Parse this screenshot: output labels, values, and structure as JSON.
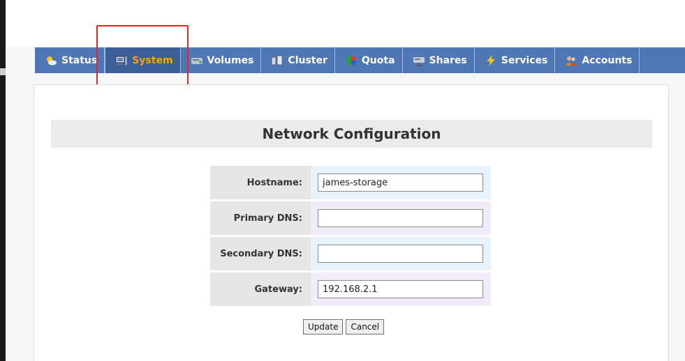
{
  "colors": {
    "tabbar_bg": "#4f77b6",
    "active_tab_text": "#f7a21c",
    "highlight_box": "#ee2222"
  },
  "tabs": [
    {
      "label": "Status",
      "icon": "weather-icon",
      "active": false
    },
    {
      "label": "System",
      "icon": "computer-icon",
      "active": true
    },
    {
      "label": "Volumes",
      "icon": "disk-drive-icon",
      "active": false
    },
    {
      "label": "Cluster",
      "icon": "cluster-icon",
      "active": false
    },
    {
      "label": "Quota",
      "icon": "pie-chart-icon",
      "active": false
    },
    {
      "label": "Shares",
      "icon": "network-drive-icon",
      "active": false
    },
    {
      "label": "Services",
      "icon": "lightning-icon",
      "active": false
    },
    {
      "label": "Accounts",
      "icon": "users-icon",
      "active": false
    }
  ],
  "network": {
    "heading": "Network Configuration",
    "fields": [
      {
        "label": "Hostname:",
        "value": "james-storage"
      },
      {
        "label": "Primary DNS:",
        "value": ""
      },
      {
        "label": "Secondary DNS:",
        "value": ""
      },
      {
        "label": "Gateway:",
        "value": "192.168.2.1"
      }
    ],
    "update_label": "Update",
    "cancel_label": "Cancel"
  }
}
